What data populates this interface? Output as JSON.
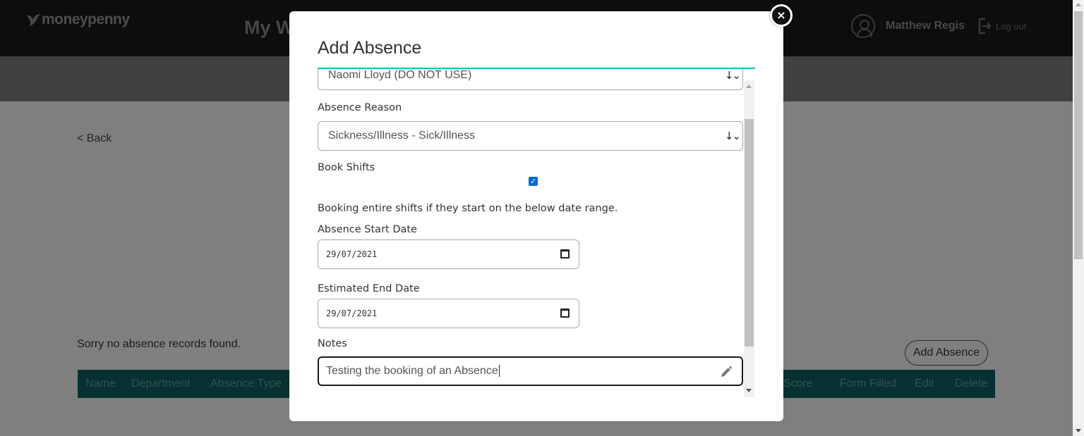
{
  "header": {
    "logo_text": "moneypenny",
    "page_title": "My W",
    "user_name": "Matthew Regis",
    "logout_label": "Log out"
  },
  "main": {
    "back_link": "< Back",
    "empty_message": "Sorry no absence records found.",
    "add_absence_button": "Add Absence",
    "table_headers": [
      "Name",
      "Department",
      "Absence Type",
      "r Score",
      "Form Filled",
      "Edit",
      "Delete"
    ]
  },
  "modal": {
    "title": "Add Absence",
    "close_label": "×",
    "employee_select": "Naomi Lloyd (DO NOT USE)",
    "absence_reason_label": "Absence Reason",
    "absence_reason_value": "Sickness/Illness - Sick/Illness",
    "book_shifts_label": "Book Shifts",
    "book_shifts_checked": true,
    "help_text": "Booking entire shifts if they start on the below date range.",
    "start_date_label": "Absence Start Date",
    "start_date_value": "29/07/2021",
    "end_date_label": "Estimated End Date",
    "end_date_value": "29/07/2021",
    "notes_label": "Notes",
    "notes_value": "Testing the booking of an Absence"
  },
  "colors": {
    "topbar": "#1a1a1a",
    "accent": "#1bb7bf",
    "table_header": "#0f6060",
    "checkbox": "#0b6bd6"
  }
}
